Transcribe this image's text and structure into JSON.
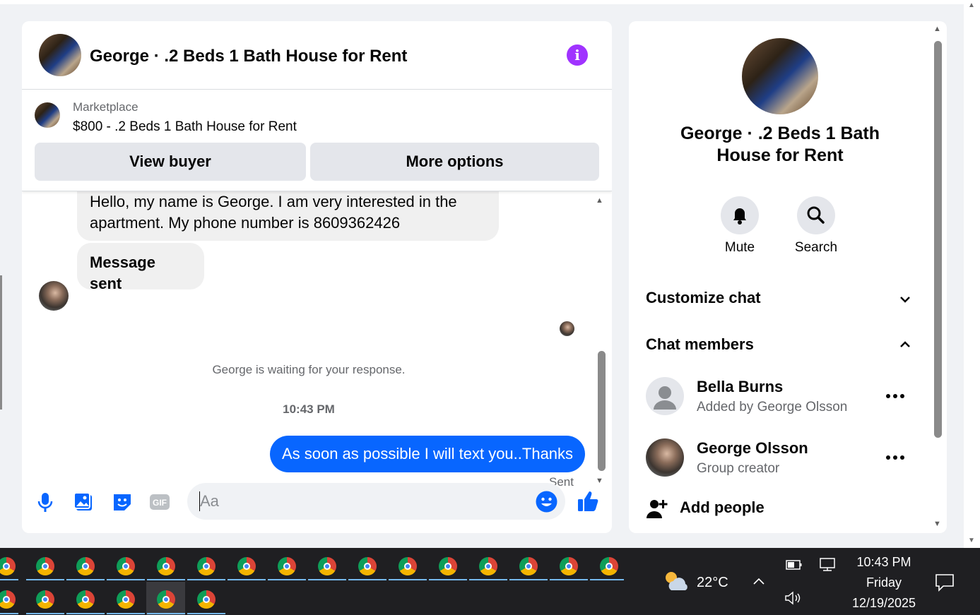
{
  "chat": {
    "title": "George · .2 Beds 1 Bath House for Rent",
    "marketplace_label": "Marketplace",
    "listing": "$800 - .2 Beds 1 Bath House for Rent",
    "view_buyer": "View buyer",
    "more_options": "More options",
    "messages": {
      "incoming_1": "Hello, my name is George. I am very interested in the apartment. My phone number is 8609362426",
      "incoming_2": "Message sent",
      "waiting": "George is waiting for your response.",
      "timestamp": "10:43 PM",
      "outgoing": "As soon as possible I will text you..Thanks",
      "status": "Sent"
    },
    "composer_placeholder": "Aa",
    "tool_icons": [
      "microphone-icon",
      "gallery-icon",
      "sticker-icon",
      "gif-icon",
      "emoji-icon",
      "thumbs-up-icon"
    ]
  },
  "panel": {
    "title": "George · .2 Beds 1 Bath House for Rent",
    "mute": "Mute",
    "search": "Search",
    "customize": "Customize chat",
    "members_title": "Chat members",
    "members": [
      {
        "name": "Bella Burns",
        "sub": "Added by George Olsson"
      },
      {
        "name": "George Olsson",
        "sub": "Group creator"
      }
    ],
    "add_people": "Add people"
  },
  "taskbar": {
    "temperature": "22°C",
    "time": "10:43 PM",
    "day": "Friday",
    "date": "12/19/2025"
  },
  "colors": {
    "accent": "#0866ff",
    "info": "#a033ff",
    "bubble_in": "#f0f0f0",
    "taskbar": "#1f1f22"
  }
}
